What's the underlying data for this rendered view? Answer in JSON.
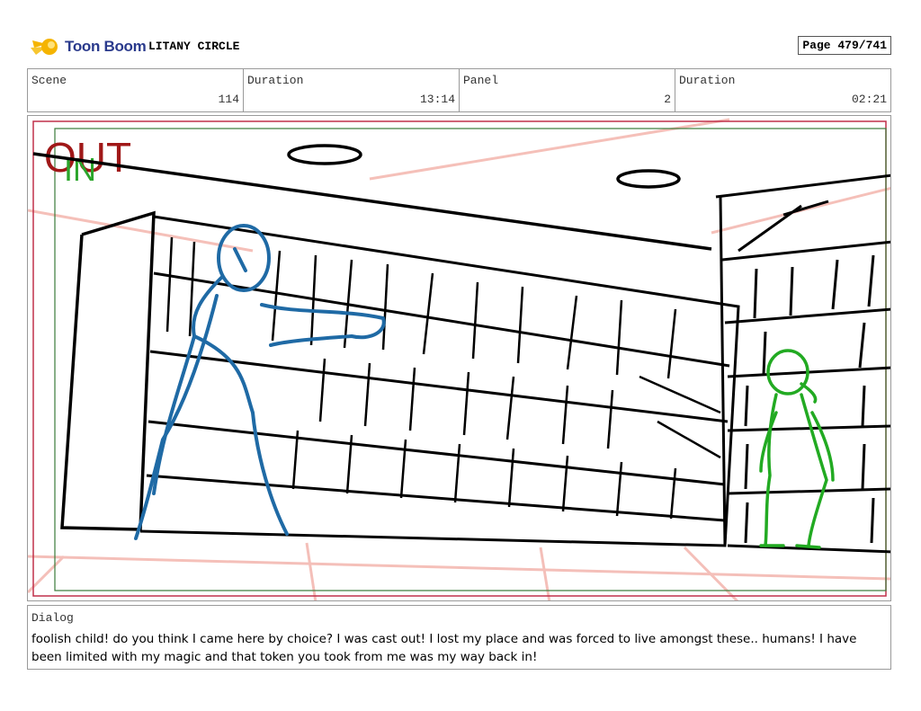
{
  "header": {
    "logo_text": "Toon Boom",
    "project_title": "LITANY CIRCLE",
    "page_label": "Page 479/741"
  },
  "info": {
    "scene_label": "Scene",
    "scene_value": "114",
    "scene_duration_label": "Duration",
    "scene_duration_value": "13:14",
    "panel_label": "Panel",
    "panel_value": "2",
    "panel_duration_label": "Duration",
    "panel_duration_value": "02:21"
  },
  "panel_image": {
    "out_label": "OUT",
    "in_label": "IN",
    "colors": {
      "out": "#a01818",
      "in": "#2aa52a",
      "blue_figure": "#1f6aa5",
      "green_figure": "#22aa22",
      "perspective": "#f2b0a8"
    }
  },
  "dialog": {
    "label": "Dialog",
    "text": "foolish child! do you think I came here by choice? I was cast out! I lost my place and was forced to live amongst these.. humans! I have been limited with my magic and that token you took from me was my way back in!"
  }
}
